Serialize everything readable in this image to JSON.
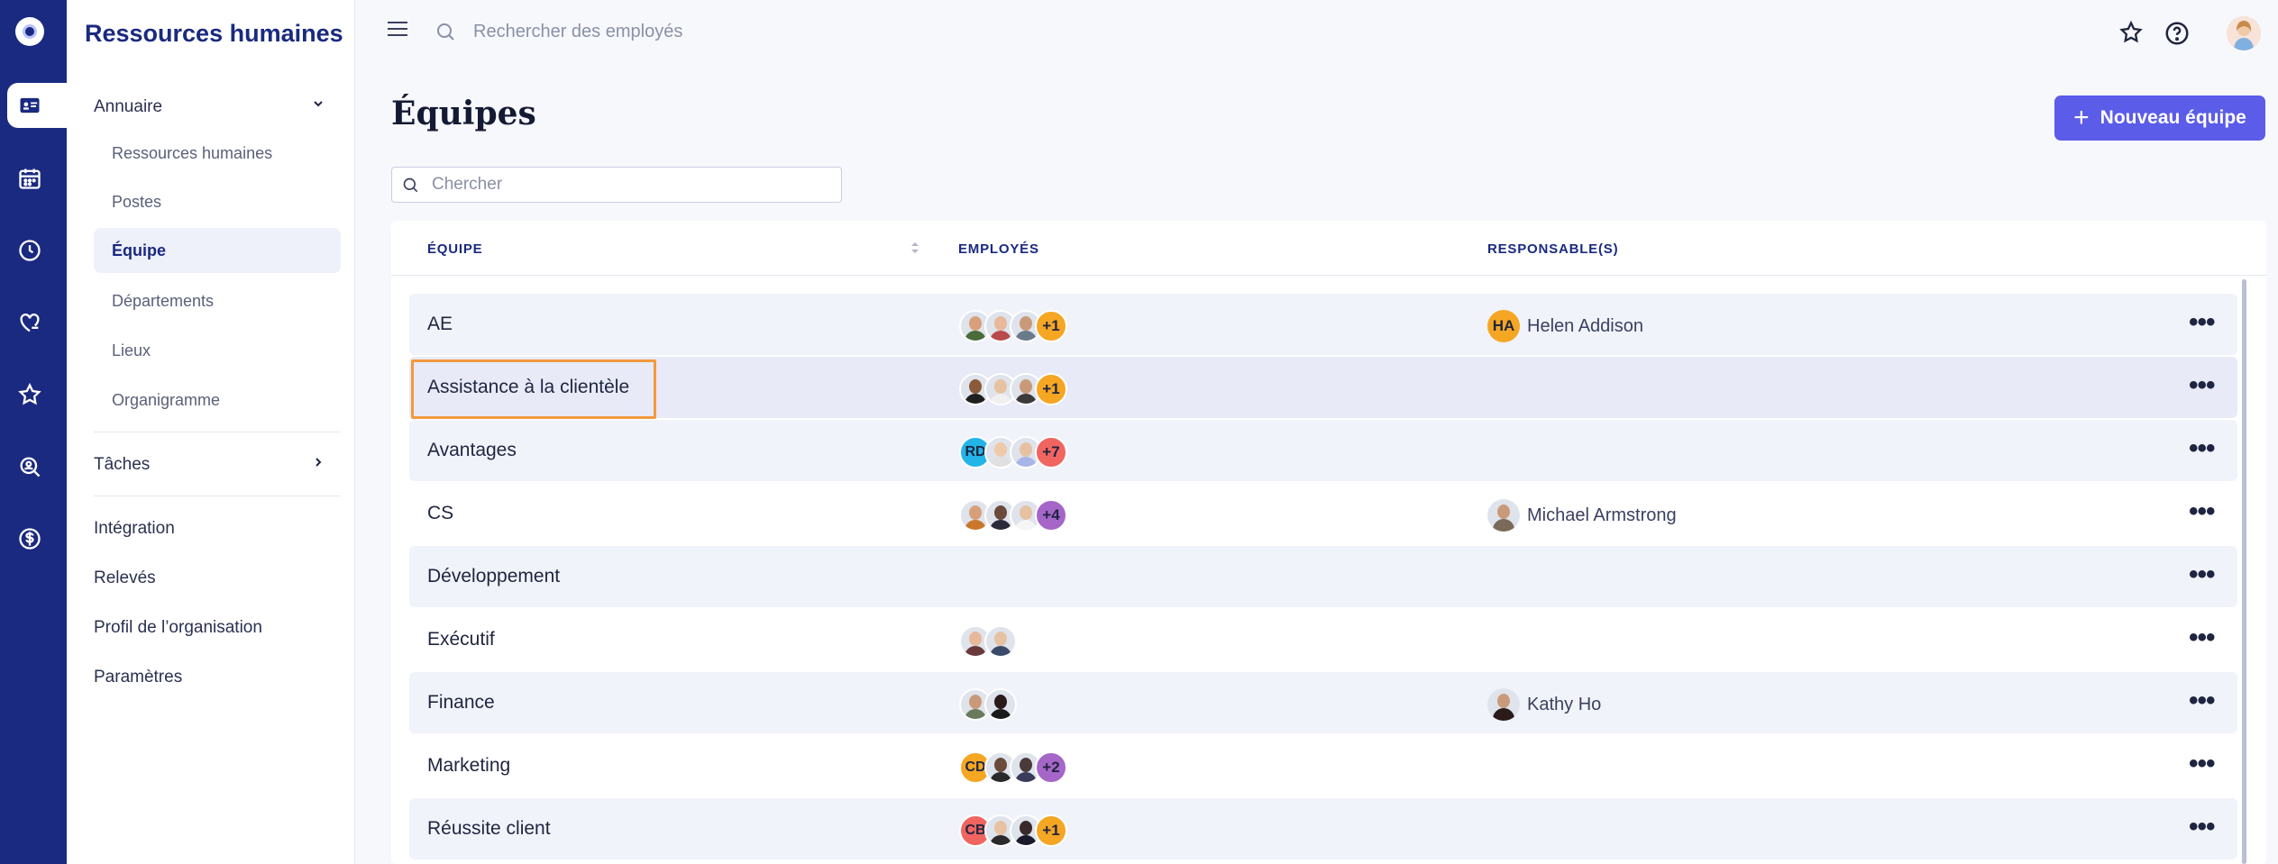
{
  "app": {
    "section_title": "Ressources humaines"
  },
  "rail": {
    "items": [
      {
        "icon": "contact-card-icon",
        "active": true
      },
      {
        "icon": "calendar-icon"
      },
      {
        "icon": "clock-icon"
      },
      {
        "icon": "heart-hand-icon"
      },
      {
        "icon": "star-icon"
      },
      {
        "icon": "search-person-icon"
      },
      {
        "icon": "dollar-icon"
      }
    ]
  },
  "sidebar": {
    "group_directory": "Annuaire",
    "directory_items": [
      "Ressources humaines",
      "Postes",
      "Équipe",
      "Départements",
      "Lieux",
      "Organigramme"
    ],
    "active_item": "Équipe",
    "group_tasks": "Tâches",
    "links": [
      "Intégration",
      "Relevés",
      "Profil de l’organisation",
      "Paramètres"
    ]
  },
  "topbar": {
    "search_placeholder": "Rechercher des employés"
  },
  "main": {
    "title": "Équipes",
    "new_button": "Nouveau équipe",
    "filter_placeholder": "Chercher",
    "columns": [
      "ÉQUIPE",
      "EMPLOYÉS",
      "RESPONSABLE(S)"
    ]
  },
  "rows": [
    {
      "team": "AE",
      "avatars": [
        {
          "skin": "#d8a07a",
          "shirt": "#4a6b3a"
        },
        {
          "skin": "#e7b89a",
          "shirt": "#b94a4a"
        },
        {
          "skin": "#c99a7a",
          "shirt": "#6a7a8a"
        }
      ],
      "more": "+1",
      "more_color": "#f5a623",
      "manager": "Helen Addison",
      "manager_initials": "HA",
      "manager_color": "#f5a623"
    },
    {
      "team": "Assistance à la clientèle",
      "avatars": [
        {
          "skin": "#8a5a3a",
          "shirt": "#1f1f1f"
        },
        {
          "skin": "#e7c2a2",
          "shirt": "#f0f0f0"
        },
        {
          "skin": "#c99a7a",
          "shirt": "#3a3a3a"
        }
      ],
      "more": "+1",
      "more_color": "#f5a623",
      "manager": "",
      "manager_initials": "",
      "manager_color": ""
    },
    {
      "team": "Avantages",
      "avatars": [
        {
          "initials": "RD",
          "bg": "#23b5e8"
        },
        {
          "skin": "#f0c9a8",
          "shirt": "#e0e0e0"
        },
        {
          "skin": "#e7c2a2",
          "shirt": "#a7b5e8"
        }
      ],
      "more": "+7",
      "more_color": "#f06560",
      "manager": "",
      "manager_initials": "",
      "manager_color": ""
    },
    {
      "team": "CS",
      "avatars": [
        {
          "skin": "#d8a07a",
          "shirt": "#c9772a"
        },
        {
          "skin": "#6a4a3a",
          "shirt": "#2a2a3a"
        },
        {
          "skin": "#e7c2a2",
          "shirt": "#f5f5f5"
        }
      ],
      "more": "+4",
      "more_color": "#a566c8",
      "manager": "Michael Armstrong",
      "manager_initials": "",
      "manager_color": "#7a6a5a"
    },
    {
      "team": "Développement",
      "avatars": [],
      "more": "",
      "more_color": "",
      "manager": "",
      "manager_initials": "",
      "manager_color": ""
    },
    {
      "team": "Exécutif",
      "avatars": [
        {
          "skin": "#e7b89a",
          "shirt": "#6a3a3a"
        },
        {
          "skin": "#e7c2a2",
          "shirt": "#3a4a6a"
        }
      ],
      "more": "",
      "more_color": "",
      "manager": "",
      "manager_initials": "",
      "manager_color": ""
    },
    {
      "team": "Finance",
      "avatars": [
        {
          "skin": "#c99a7a",
          "shirt": "#6a7a5a"
        },
        {
          "skin": "#2a1a1a",
          "shirt": "#1a1a1a"
        }
      ],
      "more": "",
      "more_color": "",
      "manager": "Kathy Ho",
      "manager_initials": "",
      "manager_color": "#2a1a1a"
    },
    {
      "team": "Marketing",
      "avatars": [
        {
          "initials": "CD",
          "bg": "#f5a623"
        },
        {
          "skin": "#6a4a3a",
          "shirt": "#2a2a2a"
        },
        {
          "skin": "#4a3a3a",
          "shirt": "#3a3a5a"
        }
      ],
      "more": "+2",
      "more_color": "#a566c8",
      "manager": "",
      "manager_initials": "",
      "manager_color": ""
    },
    {
      "team": "Réussite client",
      "avatars": [
        {
          "initials": "CB",
          "bg": "#f06560"
        },
        {
          "skin": "#e7c2a2",
          "shirt": "#2a2a2a"
        },
        {
          "skin": "#3a2a2a",
          "shirt": "#1a1a2a"
        }
      ],
      "more": "+1",
      "more_color": "#f5a623",
      "manager": "",
      "manager_initials": "",
      "manager_color": ""
    }
  ],
  "colors": {
    "rail_bg": "#1a2a80",
    "accent": "#5b5ce8",
    "highlight": "#f39a3c"
  }
}
